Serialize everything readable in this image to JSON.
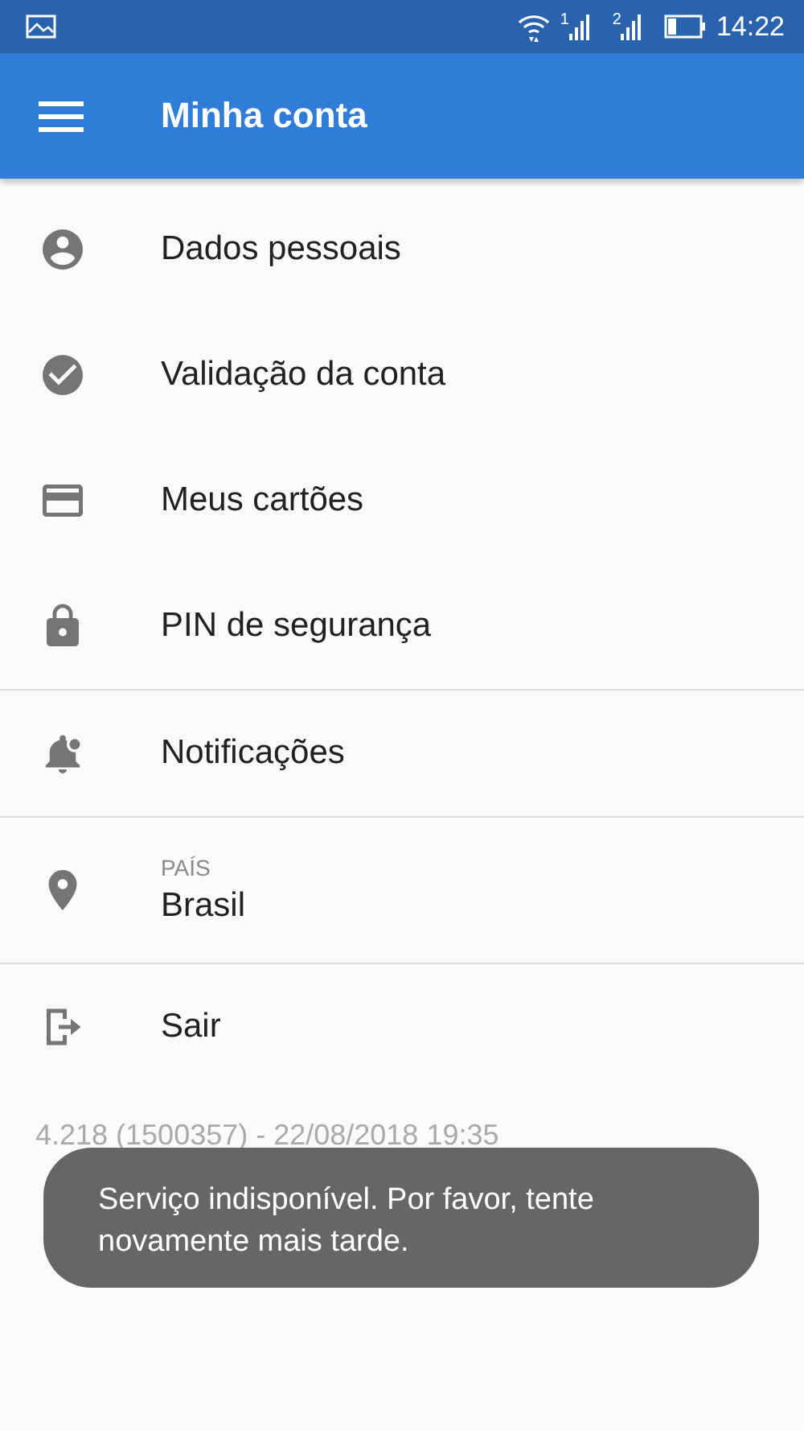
{
  "status_bar": {
    "sims": [
      "1",
      "2"
    ],
    "time": "14:22"
  },
  "app_bar": {
    "title": "Minha conta"
  },
  "sections": [
    {
      "items": [
        {
          "label": "Dados pessoais"
        },
        {
          "label": "Validação da conta"
        },
        {
          "label": "Meus cartões"
        },
        {
          "label": "PIN de segurança"
        }
      ]
    },
    {
      "items": [
        {
          "label": "Notificações"
        }
      ]
    },
    {
      "items": [
        {
          "caption": "PAÍS",
          "label": "Brasil"
        }
      ]
    },
    {
      "items": [
        {
          "label": "Sair"
        }
      ]
    }
  ],
  "version": "4.218 (1500357) - 22/08/2018 19:35",
  "toast": {
    "message": "Serviço indisponível. Por favor, tente novamente mais tarde."
  }
}
